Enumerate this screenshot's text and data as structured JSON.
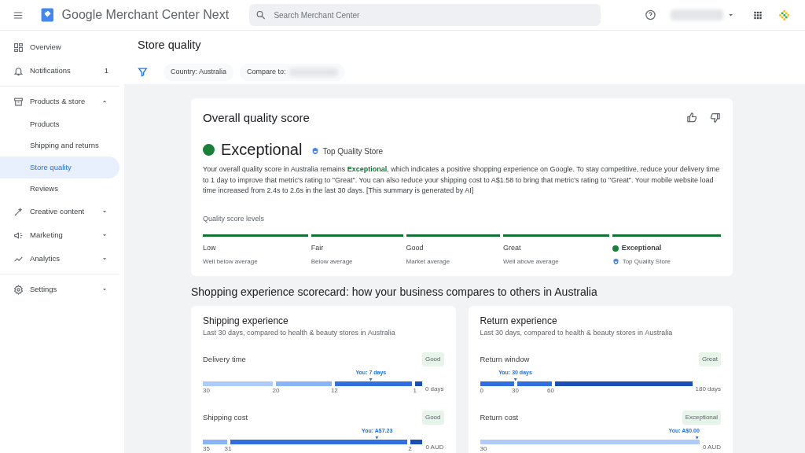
{
  "app": {
    "title": "Google Merchant Center Next",
    "search": {
      "placeholder": "Search Merchant Center"
    }
  },
  "sidebar": {
    "sections": [
      {
        "items": [
          {
            "label": "Overview",
            "selected": false
          },
          {
            "label": "Notifications",
            "count": "1",
            "selected": false
          }
        ]
      },
      {
        "items": [
          {
            "label": "Products & store",
            "selected": false,
            "expanded": true,
            "children": [
              {
                "label": "Products",
                "selected": false
              },
              {
                "label": "Shipping and returns",
                "selected": false
              },
              {
                "label": "Store quality",
                "selected": true
              },
              {
                "label": "Reviews",
                "selected": false
              }
            ]
          },
          {
            "label": "Creative content",
            "selected": false,
            "expanded": false
          },
          {
            "label": "Marketing",
            "selected": false,
            "expanded": false
          },
          {
            "label": "Analytics",
            "selected": false,
            "expanded": false
          }
        ]
      },
      {
        "items": [
          {
            "label": "Settings",
            "selected": false,
            "expanded": false
          }
        ]
      }
    ]
  },
  "page": {
    "title": "Store quality",
    "filters": [
      {
        "label": "Country: Australia",
        "blurred": false
      },
      {
        "label": "Compare to:",
        "blurred": true
      }
    ]
  },
  "overall": {
    "title": "Overall quality score",
    "rating": "Exceptional",
    "badge": "Top Quality Store",
    "summary": "Your overall quality score in Australia remains **Exceptional**, which indicates a positive shopping experience on Google. To stay competitive, reduce your delivery time to 1 day to improve that metric's rating to \"Great\". You can also reduce your shipping cost to A$1.58 to bring that metric's rating to \"Great\". Your mobile website load time increased from 2.4s to 2.6s in the last 30 days. [This summary is generated by AI]",
    "levels_title": "Quality score levels",
    "levels": [
      {
        "label": "Low",
        "description": "Well below average",
        "selected": false,
        "kind": "plain"
      },
      {
        "label": "Fair",
        "description": "Below average",
        "selected": false,
        "kind": "plain"
      },
      {
        "label": "Good",
        "description": "Market average",
        "selected": false,
        "kind": "plain"
      },
      {
        "label": "Great",
        "description": "Well above average",
        "selected": false,
        "kind": "plain"
      },
      {
        "label": "Exceptional",
        "description": "Top Quality Store",
        "selected": true,
        "kind": "badge"
      }
    ]
  },
  "scorecard": {
    "title": "Shopping experience scorecard: how your business compares to others in Australia",
    "cards": [
      {
        "title": "Shipping experience",
        "subtitle": "Last 30 days, compared to health & beauty stores in Australia",
        "metrics": [
          {
            "name": "Delivery time",
            "rating": "Good",
            "marker": {
              "text": "You: 7 days"
            },
            "end_label": "0 days",
            "segments": [
              {
                "label": "30",
                "color": "#aecbfa"
              },
              {
                "label": "20",
                "color": "#8ab4f8"
              },
              {
                "label": "12",
                "color": "#2f6fe0"
              },
              {
                "label": "1",
                "color": "#1a4fb5"
              }
            ]
          },
          {
            "name": "Shipping cost",
            "rating": "Good",
            "marker": {
              "text": "You: A$7.23"
            },
            "end_label": "0 AUD",
            "segments": [
              {
                "label": "35",
                "color": "#8ab4f8"
              },
              {
                "label": "31",
                "color": "#2f6fe0"
              },
              {
                "label": "2",
                "color": "#1a4fb5"
              }
            ]
          }
        ]
      },
      {
        "title": "Return experience",
        "subtitle": "Last 30 days, compared to health & beauty stores in Australia",
        "metrics": [
          {
            "name": "Return window",
            "rating": "Great",
            "marker": {
              "text": "You: 30 days"
            },
            "end_label": "180 days",
            "segments": [
              {
                "label": "0",
                "color": "#2f6fe0"
              },
              {
                "label": "30",
                "color": "#2f6fe0"
              },
              {
                "label": "60",
                "color": "#1a4fb5"
              }
            ]
          },
          {
            "name": "Return cost",
            "rating": "Exceptional",
            "marker": {
              "text": "You: A$0.00"
            },
            "end_label": "0 AUD",
            "segments": [
              {
                "label": "30",
                "color": "#aecbfa"
              }
            ]
          }
        ]
      }
    ]
  }
}
